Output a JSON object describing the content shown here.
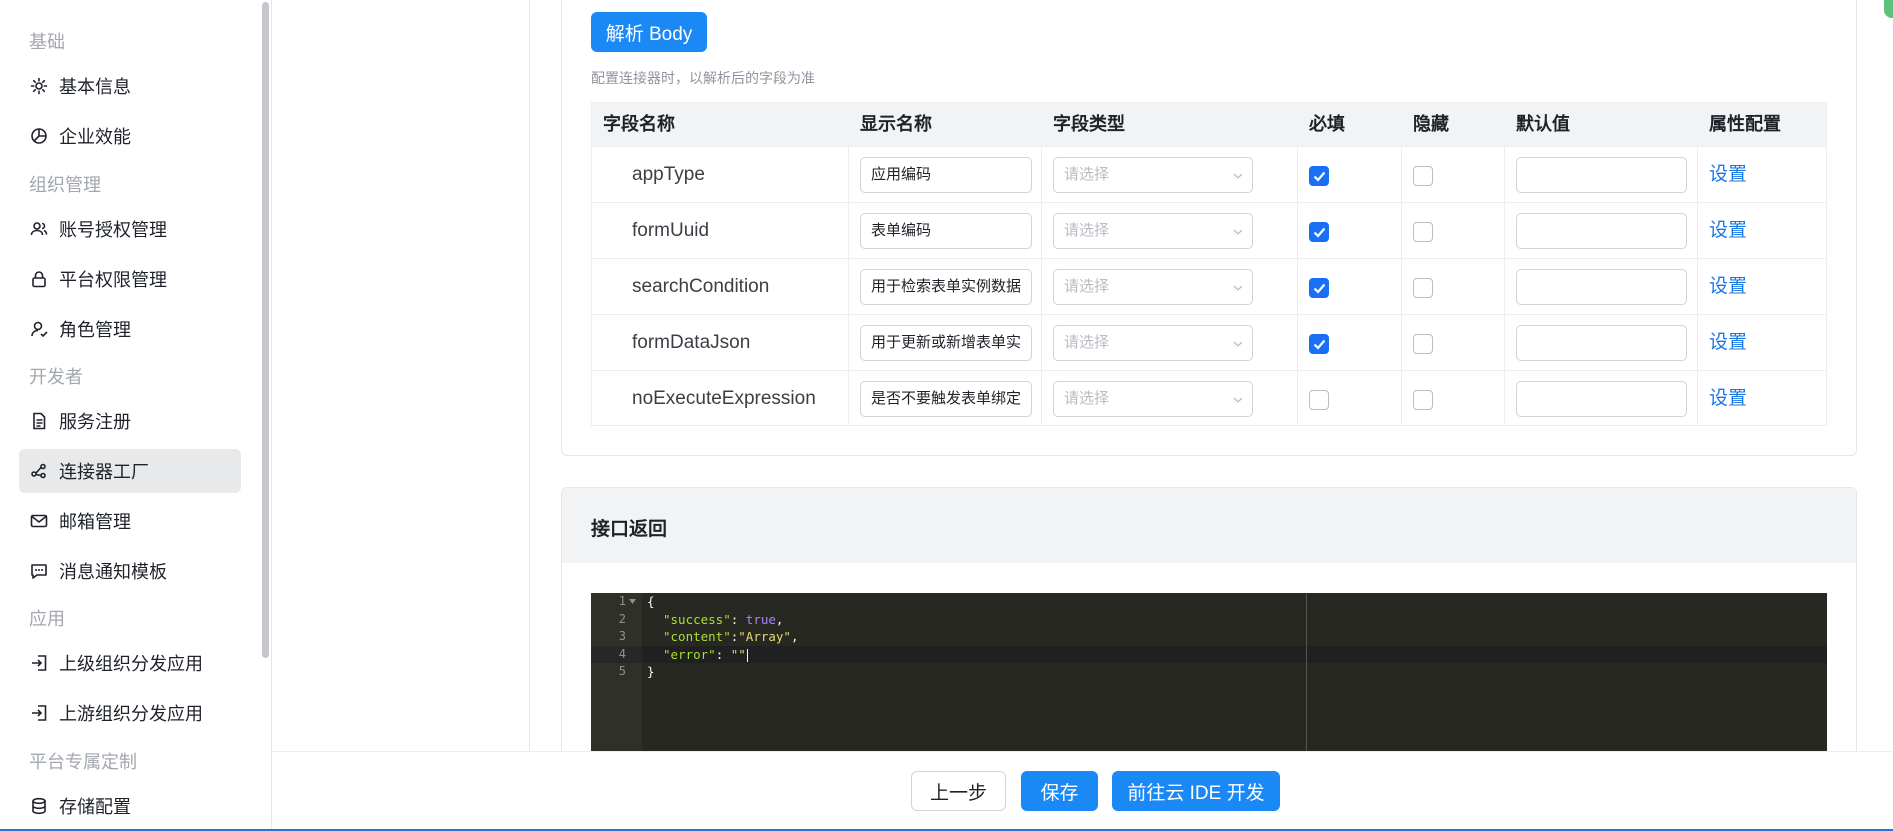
{
  "sidebar": {
    "groups": [
      "基础",
      "组织管理",
      "开发者",
      "应用",
      "平台专属定制"
    ],
    "items": [
      {
        "label": "基本信息",
        "icon": "gear-icon"
      },
      {
        "label": "企业效能",
        "icon": "pie-chart-icon"
      },
      {
        "label": "账号授权管理",
        "icon": "users-icon"
      },
      {
        "label": "平台权限管理",
        "icon": "lock-icon"
      },
      {
        "label": "角色管理",
        "icon": "user-role-icon"
      },
      {
        "label": "服务注册",
        "icon": "document-icon"
      },
      {
        "label": "连接器工厂",
        "icon": "connector-icon",
        "active": true
      },
      {
        "label": "邮箱管理",
        "icon": "mail-icon"
      },
      {
        "label": "消息通知模板",
        "icon": "message-icon"
      },
      {
        "label": "上级组织分发应用",
        "icon": "login-icon"
      },
      {
        "label": "上游组织分发应用",
        "icon": "login-icon"
      },
      {
        "label": "存储配置",
        "icon": "database-icon"
      }
    ]
  },
  "body_section": {
    "parse_button": "解析 Body",
    "hint": "配置连接器时，以解析后的字段为准",
    "columns": [
      "字段名称",
      "显示名称",
      "字段类型",
      "必填",
      "隐藏",
      "默认值",
      "属性配置"
    ],
    "select_placeholder": "请选择",
    "link_label": "设置",
    "rows": [
      {
        "field": "appType",
        "display": "应用编码",
        "required": true,
        "hidden": false,
        "default": ""
      },
      {
        "field": "formUuid",
        "display": "表单编码",
        "required": true,
        "hidden": false,
        "default": ""
      },
      {
        "field": "searchCondition",
        "display": "用于检索表单实例数据",
        "required": true,
        "hidden": false,
        "default": ""
      },
      {
        "field": "formDataJson",
        "display": "用于更新或新增表单实",
        "required": true,
        "hidden": false,
        "default": ""
      },
      {
        "field": "noExecuteExpression",
        "display": "是否不要触发表单绑定",
        "required": false,
        "hidden": false,
        "default": ""
      }
    ]
  },
  "response_section": {
    "title": "接口返回",
    "code_lines": [
      {
        "n": "1",
        "text": "{"
      },
      {
        "n": "2",
        "key": "\"success\"",
        "sep": ": ",
        "val": "true",
        "val_type": "bool",
        "tail": ","
      },
      {
        "n": "3",
        "key": "\"content\"",
        "sep": ":",
        "val": "\"Array\"",
        "val_type": "str",
        "tail": ","
      },
      {
        "n": "4",
        "key": "\"error\"",
        "sep": ": ",
        "val": "\"\"",
        "val_type": "str",
        "tail": ""
      },
      {
        "n": "5",
        "text": "}"
      }
    ]
  },
  "footer": {
    "prev": "上一步",
    "save": "保存",
    "ide": "前往云 IDE 开发"
  },
  "colors": {
    "primary": "#1a88f5",
    "link": "#1a77e6",
    "editor_bg": "#272822"
  }
}
